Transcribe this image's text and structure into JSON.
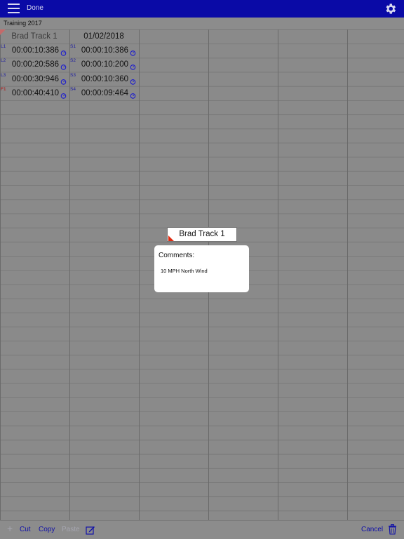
{
  "header": {
    "done_label": "Done",
    "menu_icon": "hamburger-icon",
    "settings_icon": "gear-icon",
    "bar_color": "#0a0aa6"
  },
  "sheet": {
    "title": "Training 2017",
    "header_row": [
      "Brad Track 1",
      "01/02/2018"
    ],
    "rows": [
      {
        "lap_label": "L1",
        "lap_time": "00:00:10:386",
        "split_label": "S1",
        "split_time": "00:00:10:386",
        "lap_label_color": "#1a1aa0"
      },
      {
        "lap_label": "L2",
        "lap_time": "00:00:20:586",
        "split_label": "S2",
        "split_time": "00:00:10:200",
        "lap_label_color": "#1a1aa0"
      },
      {
        "lap_label": "L3",
        "lap_time": "00:00:30:946",
        "split_label": "S3",
        "split_time": "00:00:10:360",
        "lap_label_color": "#1a1aa0"
      },
      {
        "lap_label": "F1",
        "lap_time": "00:00:40:410",
        "split_label": "S4",
        "split_time": "00:00:09:464",
        "lap_label_color": "#b01010"
      }
    ]
  },
  "comment_popup": {
    "cell_name": "Brad Track 1",
    "title": "Comments:",
    "text": "10 MPH North Wind"
  },
  "toolbar": {
    "add_label": "+",
    "cut_label": "Cut",
    "copy_label": "Copy",
    "paste_label": "Paste",
    "cancel_label": "Cancel",
    "edit_icon": "edit-icon",
    "trash_icon": "trash-icon",
    "accent_color": "#1010a8"
  }
}
